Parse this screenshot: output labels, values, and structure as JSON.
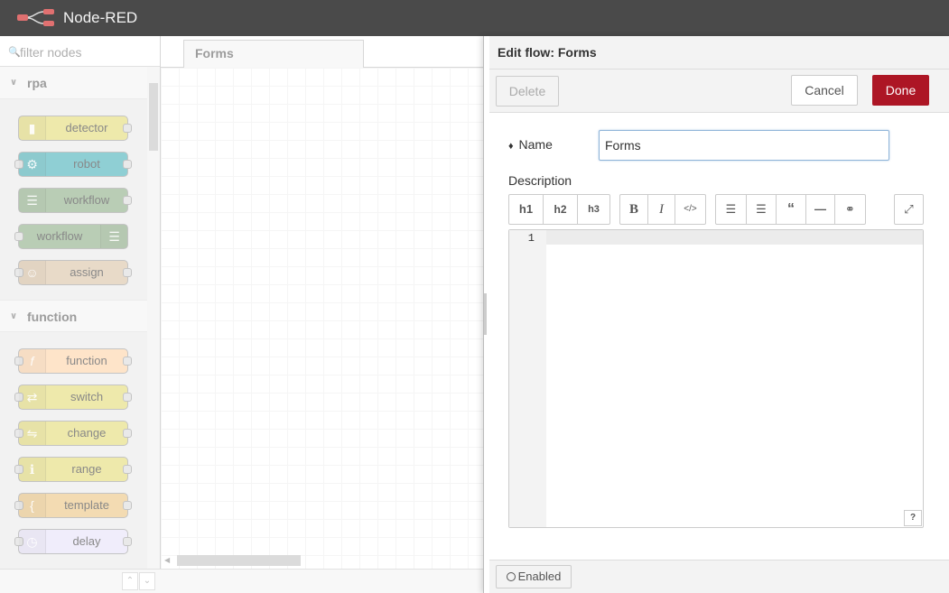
{
  "app": {
    "title": "Node-RED"
  },
  "palette": {
    "search_placeholder": "filter nodes",
    "categories": [
      {
        "name": "rpa",
        "nodes": [
          {
            "label": "detector",
            "color": "#e2d96e",
            "icon": "signal-icon"
          },
          {
            "label": "robot",
            "color": "#3fadb5",
            "icon": "robot-icon"
          },
          {
            "label": "workflow",
            "color": "#87a980",
            "icon": "workflow-in-icon"
          },
          {
            "label": "workflow",
            "color": "#87a980",
            "icon": "workflow-out-icon"
          },
          {
            "label": "assign",
            "color": "#d8bfa0",
            "icon": "assign-icon"
          }
        ]
      },
      {
        "name": "function",
        "nodes": [
          {
            "label": "function",
            "color": "#fdd0a2",
            "icon": "function-icon"
          },
          {
            "label": "switch",
            "color": "#e2d96e",
            "icon": "switch-icon"
          },
          {
            "label": "change",
            "color": "#e2d96e",
            "icon": "change-icon"
          },
          {
            "label": "range",
            "color": "#e2d96e",
            "icon": "range-icon"
          },
          {
            "label": "template",
            "color": "#ebc17a",
            "icon": "template-icon"
          },
          {
            "label": "delay",
            "color": "#e6e0f8",
            "icon": "timer-icon"
          }
        ]
      }
    ]
  },
  "workspace": {
    "tabs": [
      {
        "label": "Forms"
      }
    ]
  },
  "tray": {
    "title": "Edit flow: Forms",
    "delete_label": "Delete",
    "cancel_label": "Cancel",
    "done_label": "Done",
    "name_label": "Name",
    "name_value": "Forms",
    "description_label": "Description",
    "toolbar": {
      "heading": [
        "h1",
        "h2",
        "h3"
      ],
      "format": [
        "B",
        "I",
        "</>"
      ]
    },
    "editor_line_numbers": [
      "1"
    ],
    "help_label": "?",
    "enabled_label": "Enabled"
  }
}
